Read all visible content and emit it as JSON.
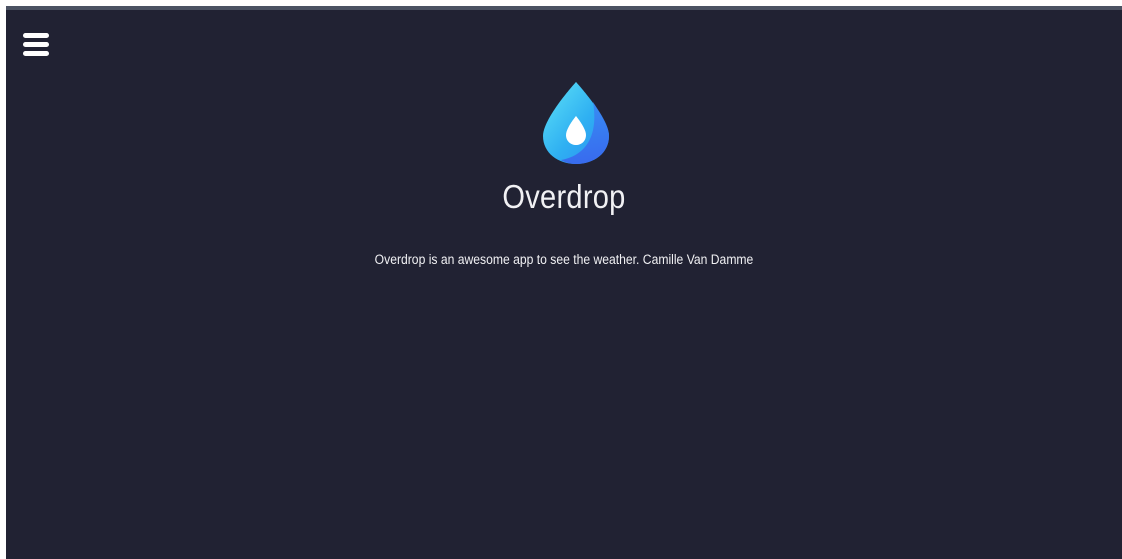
{
  "header": {
    "menu_icon": "hamburger-menu-icon"
  },
  "logo": {
    "icon": "water-drop-icon",
    "colors": {
      "light": "#4fd8f4",
      "mid": "#2fa9f0",
      "dark": "#3a6ef0",
      "inner": "#ffffff"
    }
  },
  "main": {
    "title": "Overdrop",
    "description": "Overdrop is an awesome app to see the weather. Camille Van Damme"
  },
  "theme": {
    "background": "#212233",
    "text": "#f1f1f4"
  }
}
